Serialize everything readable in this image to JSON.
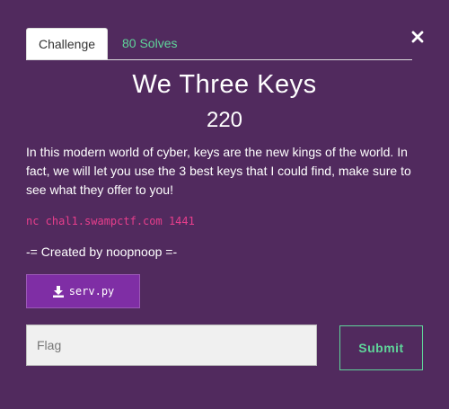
{
  "modal": {
    "close_glyph": "✕"
  },
  "tabs": [
    {
      "label": "Challenge",
      "active": true
    },
    {
      "label": "80 Solves",
      "active": false
    }
  ],
  "challenge": {
    "title": "We Three Keys",
    "points": "220",
    "description": "In this modern world of cyber, keys are the new kings of the world. In fact, we will let you use the 3 best keys that I could find, make sure to see what they offer to you!",
    "connection": "nc chal1.swampctf.com 1441",
    "credit": "-= Created by noopnoop =-",
    "file": {
      "label": "serv.py",
      "icon": "download-icon"
    }
  },
  "form": {
    "flag_placeholder": "Flag",
    "flag_value": "",
    "submit_label": "Submit"
  },
  "colors": {
    "background": "#512a5e",
    "accent_green": "#5fd59a",
    "file_button": "#7f2ea5",
    "code_pink": "#e83e8c"
  }
}
